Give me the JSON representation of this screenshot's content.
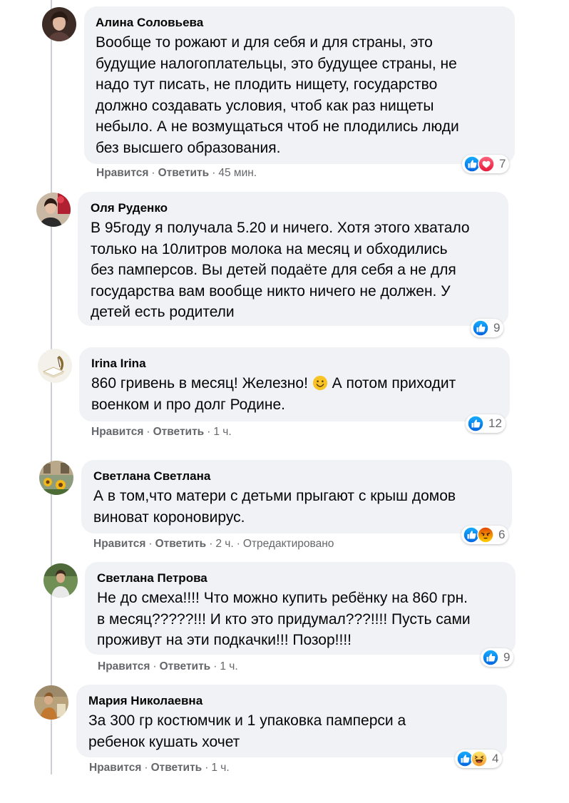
{
  "comments": [
    {
      "author": "Алина Соловьева",
      "text": "Вообще то рожают и для себя и для страны, это\nбудущие налогоплательцы, это будущее страны, не\nнадо тут писать, не плодить нищету, государство\nдолжно создавать условия, чтоб как раз нищеты\nнебыло. А не возмущаться чтоб не плодились люди\nбез высшего образования.",
      "reactions": [
        "like-icon",
        "love-icon"
      ],
      "reaction_count": "7",
      "like_label": "Нравится",
      "reply_label": "Ответить",
      "time": "45 мин."
    },
    {
      "author": "Оля Руденко",
      "text": "В 95году я получала 5.20 и ничего. Хотя этого хватало\nтолько на 10литров молока на месяц и обходились\nбез памперсов. Вы детей подаёте для себя а не для\nгосударства вам вообще никто ничего не должен. У\nдетей есть родители",
      "reactions": [
        "like-icon"
      ],
      "reaction_count": "9"
    },
    {
      "author": "Irina Irina",
      "text_before": "860 гривень в месяц! Железно!",
      "text_after": "А потом приходит\nвоенком и про долг Родине.",
      "reactions": [
        "like-icon"
      ],
      "reaction_count": "12",
      "like_label": "Нравится",
      "reply_label": "Ответить",
      "time": "1 ч."
    },
    {
      "author": "Светлана Светлана",
      "text": "А в том,что матери с детьми прыгают с крыш домов\nвиноват короновирус.",
      "reactions": [
        "like-icon",
        "angry-icon"
      ],
      "reaction_count": "6",
      "like_label": "Нравится",
      "reply_label": "Ответить",
      "time": "2 ч.",
      "edited": "Отредактировано"
    },
    {
      "author": "Светлана Петрова",
      "text": "Не до смеха!!!! Что можно купить ребёнку на 860 грн.\nв месяц?????!!! И кто это придумал???!!!! Пусть сами\nпроживут на эти подкачки!!! Позор!!!!",
      "reactions": [
        "like-icon"
      ],
      "reaction_count": "9",
      "like_label": "Нравится",
      "reply_label": "Ответить",
      "time": "1 ч."
    },
    {
      "author": "Мария Николаевна",
      "text": "За 300 гр костюмчик и 1 упаковка памперси а\nребенок кушать хочет",
      "reactions": [
        "like-icon",
        "haha-icon"
      ],
      "reaction_count": "4",
      "like_label": "Нравится",
      "reply_label": "Ответить",
      "time": "1 ч."
    }
  ],
  "colors": {
    "bubble": "#f0f2f5",
    "meta": "#65676b",
    "like": "#1877f2",
    "love": "#f33e58",
    "angry": "#e9710f",
    "haha": "#f7b125"
  }
}
